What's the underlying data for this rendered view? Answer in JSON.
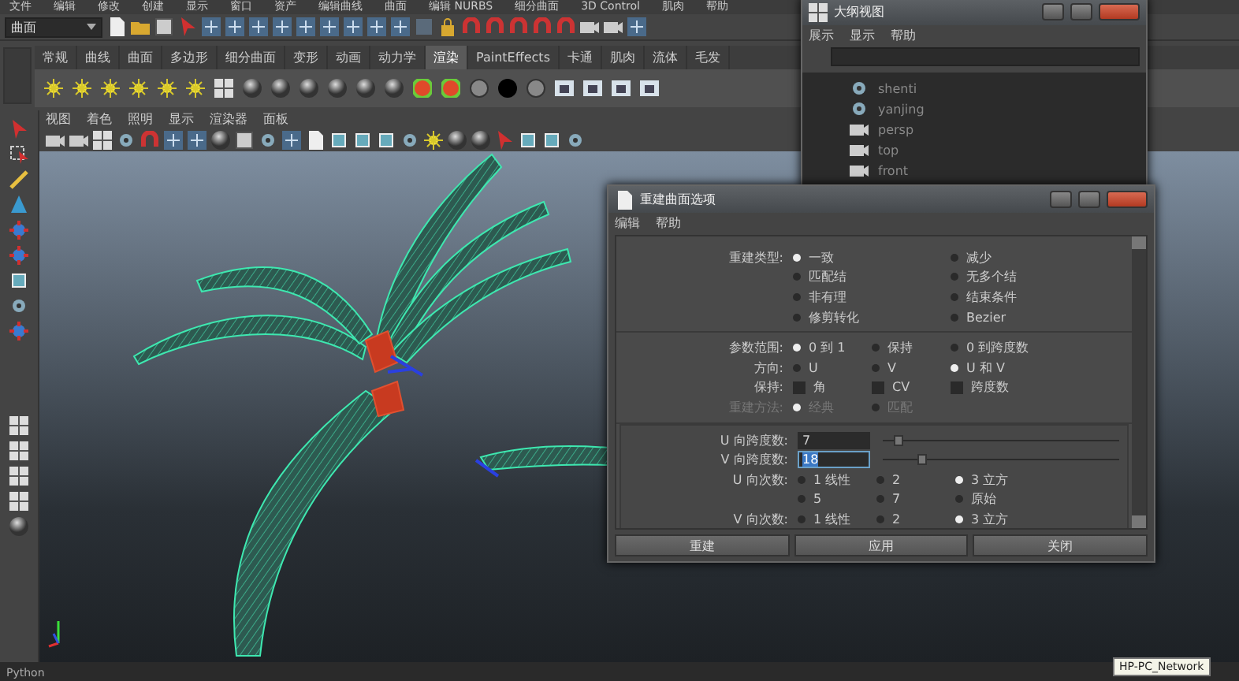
{
  "menu_bar": [
    "文件",
    "编辑",
    "修改",
    "创建",
    "显示",
    "窗口",
    "资产",
    "编辑曲线",
    "曲面",
    "编辑 NURBS",
    "细分曲面",
    "3D Control",
    "肌肉",
    "帮助"
  ],
  "toolbar": {
    "mode": "曲面"
  },
  "shelf_tabs": [
    {
      "label": "常规",
      "selected": false
    },
    {
      "label": "曲线",
      "selected": false
    },
    {
      "label": "曲面",
      "selected": false
    },
    {
      "label": "多边形",
      "selected": false
    },
    {
      "label": "细分曲面",
      "selected": false
    },
    {
      "label": "变形",
      "selected": false
    },
    {
      "label": "动画",
      "selected": false
    },
    {
      "label": "动力学",
      "selected": false
    },
    {
      "label": "渲染",
      "selected": true
    },
    {
      "label": "PaintEffects",
      "selected": false
    },
    {
      "label": "卡通",
      "selected": false
    },
    {
      "label": "肌肉",
      "selected": false
    },
    {
      "label": "流体",
      "selected": false
    },
    {
      "label": "毛发",
      "selected": false
    }
  ],
  "viewport": {
    "menu": [
      "视图",
      "着色",
      "照明",
      "显示",
      "渲染器",
      "面板"
    ]
  },
  "outliner": {
    "title": "大纲视图",
    "menu": [
      "展示",
      "显示",
      "帮助"
    ],
    "items": [
      "shenti",
      "yanjing",
      "persp",
      "top",
      "front"
    ]
  },
  "dialog": {
    "title": "重建曲面选项",
    "menu": [
      "编辑",
      "帮助"
    ],
    "sections": [
      {
        "rows": [
          {
            "kind": "pair",
            "label": "重建类型:",
            "options": [
              {
                "text": "一致",
                "selected": true
              },
              {
                "text": "减少",
                "selected": false
              }
            ]
          },
          {
            "kind": "pair",
            "options": [
              {
                "text": "匹配结",
                "selected": false
              },
              {
                "text": "无多个结",
                "selected": false
              }
            ]
          },
          {
            "kind": "pair",
            "options": [
              {
                "text": "非有理",
                "selected": false
              },
              {
                "text": "结束条件",
                "selected": false
              }
            ]
          },
          {
            "kind": "pair",
            "options": [
              {
                "text": "修剪转化",
                "selected": false
              },
              {
                "text": "Bezier",
                "selected": false
              }
            ]
          }
        ]
      },
      {
        "rows": [
          {
            "kind": "radio",
            "label": "参数范围:",
            "options": [
              {
                "text": "0 到 1",
                "selected": true
              },
              {
                "text": "保持",
                "selected": false
              },
              {
                "text": "0 到跨度数",
                "selected": false
              }
            ]
          },
          {
            "kind": "radio",
            "label": "方向:",
            "options": [
              {
                "text": "U",
                "selected": false
              },
              {
                "text": "V",
                "selected": false
              },
              {
                "text": "U 和 V",
                "selected": true
              }
            ]
          },
          {
            "kind": "check",
            "label": "保持:",
            "options": [
              {
                "text": "角",
                "checked": false
              },
              {
                "text": "CV",
                "checked": false
              },
              {
                "text": "跨度数",
                "checked": false
              }
            ]
          },
          {
            "kind": "radio",
            "label": "重建方法:",
            "disabled": true,
            "options": [
              {
                "text": "经典",
                "selected": true
              },
              {
                "text": "匹配",
                "selected": false
              }
            ]
          }
        ]
      },
      {
        "boxed": true,
        "rows": [
          {
            "kind": "slider",
            "label": "U 向跨度数:",
            "value": "7",
            "focused": false,
            "level": 0.05
          },
          {
            "kind": "slider",
            "label": "V 向跨度数:",
            "value": "18",
            "focused": true,
            "level": 0.15
          },
          {
            "kind": "radio",
            "label": "U 向次数:",
            "options": [
              {
                "text": "1 线性",
                "selected": false
              },
              {
                "text": "2",
                "selected": false
              },
              {
                "text": "3 立方",
                "selected": true
              }
            ]
          },
          {
            "kind": "radio",
            "options": [
              {
                "text": "5",
                "selected": false
              },
              {
                "text": "7",
                "selected": false
              },
              {
                "text": "原始",
                "selected": false
              }
            ]
          },
          {
            "kind": "radio",
            "label": "V 向次数:",
            "options": [
              {
                "text": "1 线性",
                "selected": false
              },
              {
                "text": "2",
                "selected": false
              },
              {
                "text": "3 立方",
                "selected": true
              }
            ]
          }
        ]
      }
    ],
    "buttons": [
      "重建",
      "应用",
      "关闭"
    ]
  },
  "status": {
    "command_label": "Python",
    "tooltip": "HP-PC_Network"
  }
}
